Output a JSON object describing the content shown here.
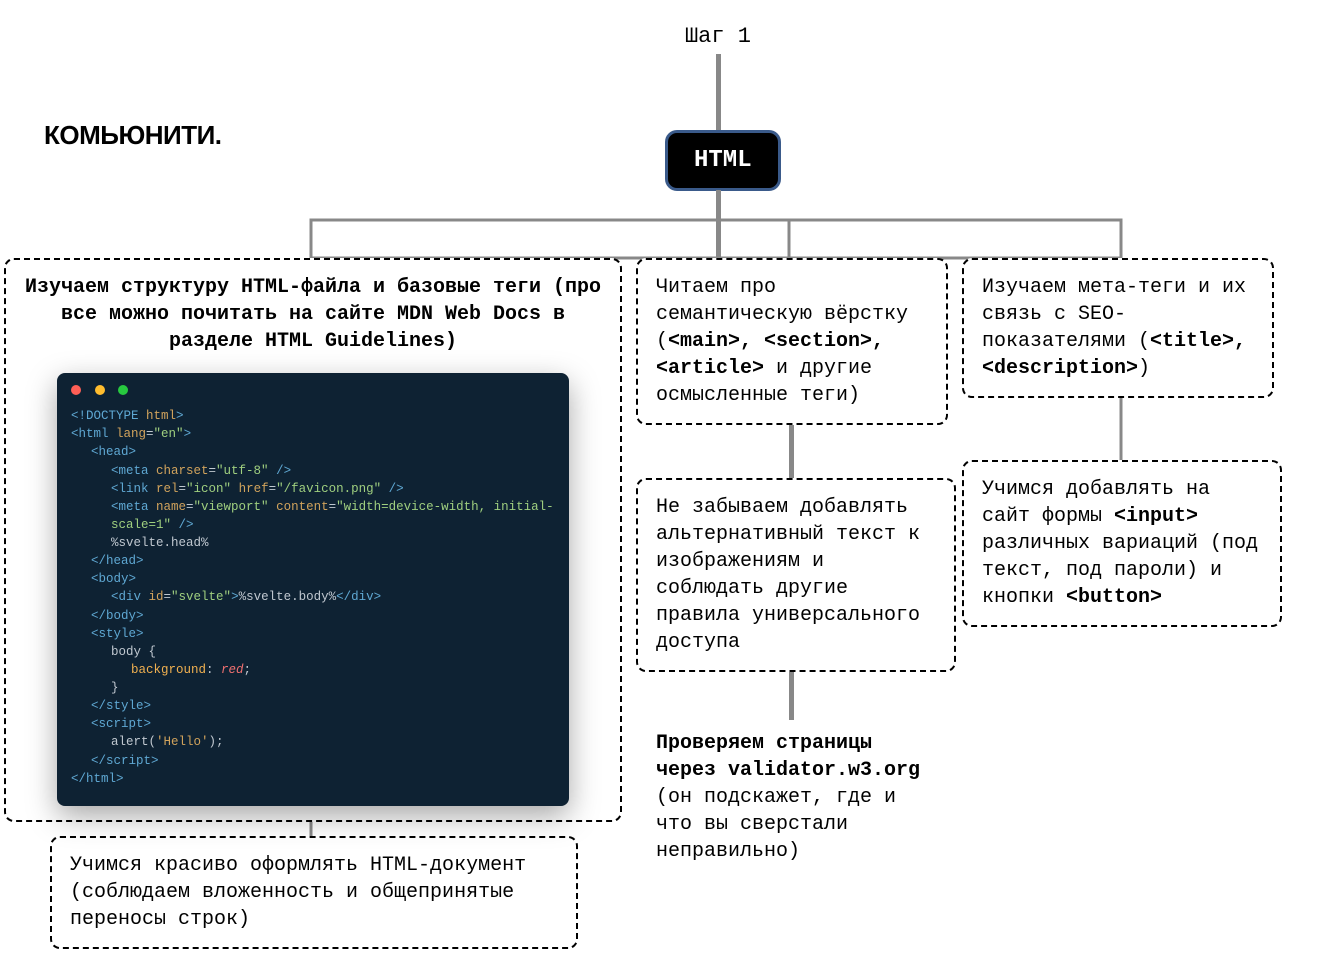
{
  "step_label": "Шаг 1",
  "logo": "КОМЬЮНИТИ.",
  "main_node": "HTML",
  "boxes": {
    "b1_title": "Изучаем структуру HTML-файла и базовые теги (про все можно почитать на сайте MDN Web Docs в разделе HTML Guidelines)",
    "b2_pre": "Читаем про семантическую вёрстку (",
    "b2_tags": "<main>, <section>, <article>",
    "b2_post": " и другие осмысленные теги)",
    "b3_pre": "Изучаем мета-теги и их связь с SEO-показателями (",
    "b3_tags": "<title>, <description>",
    "b3_post": ")",
    "b4": "Не забываем добавлять альтернативный текст к изображениям и соблюдать другие правила универсального доступа",
    "b5_pre": "Учимся добавлять на сайт формы ",
    "b5_input": "<input>",
    "b5_mid": " различных вариаций (под текст, под пароли) и кнопки ",
    "b5_button": "<button>",
    "validator_bold": "Проверяем страницы через validator.w3.org",
    "validator_rest": " (он подскажет, где и что вы сверстали неправильно)",
    "b6": "Учимся красиво оформлять HTML-документ (соблюдаем вложенность и общепринятые переносы строк)"
  },
  "code": {
    "l1_a": "<!DOCTYPE ",
    "l1_b": "html",
    "l1_c": ">",
    "l2_a": "<html ",
    "l2_attr": "lang",
    "l2_eq": "=",
    "l2_val": "\"en\"",
    "l2_c": ">",
    "l3": "<head>",
    "l4_a": "<meta ",
    "l4_attr": "charset",
    "l4_eq": "=",
    "l4_val": "\"utf-8\"",
    "l4_c": " />",
    "l5_a": "<link ",
    "l5_attr1": "rel",
    "l5_eq": "=",
    "l5_val1": "\"icon\"",
    "l5_sp": " ",
    "l5_attr2": "href",
    "l5_val2": "\"/favicon.png\"",
    "l5_c": " />",
    "l6_a": "<meta ",
    "l6_attr1": "name",
    "l6_val1": "\"viewport\"",
    "l6_attr2": "content",
    "l6_val2": "\"width=device-width, initial-scale=1\"",
    "l6_c": " />",
    "l7": "%svelte.head%",
    "l8": "</head>",
    "l9": "<body>",
    "l10_a": "<div ",
    "l10_attr": "id",
    "l10_val": "\"svelte\"",
    "l10_b": ">",
    "l10_txt": "%svelte.body%",
    "l10_c": "</div>",
    "l11": "</body>",
    "l12": "<style>",
    "l13": "body {",
    "l14_prop": "background",
    "l14_colon": ": ",
    "l14_val": "red",
    "l14_semi": ";",
    "l15": "}",
    "l16": "</style>",
    "l17": "<script>",
    "l18_fn": "alert",
    "l18_p1": "(",
    "l18_arg": "'Hello'",
    "l18_p2": ");",
    "l19": "</script>",
    "l20": "</html>"
  }
}
